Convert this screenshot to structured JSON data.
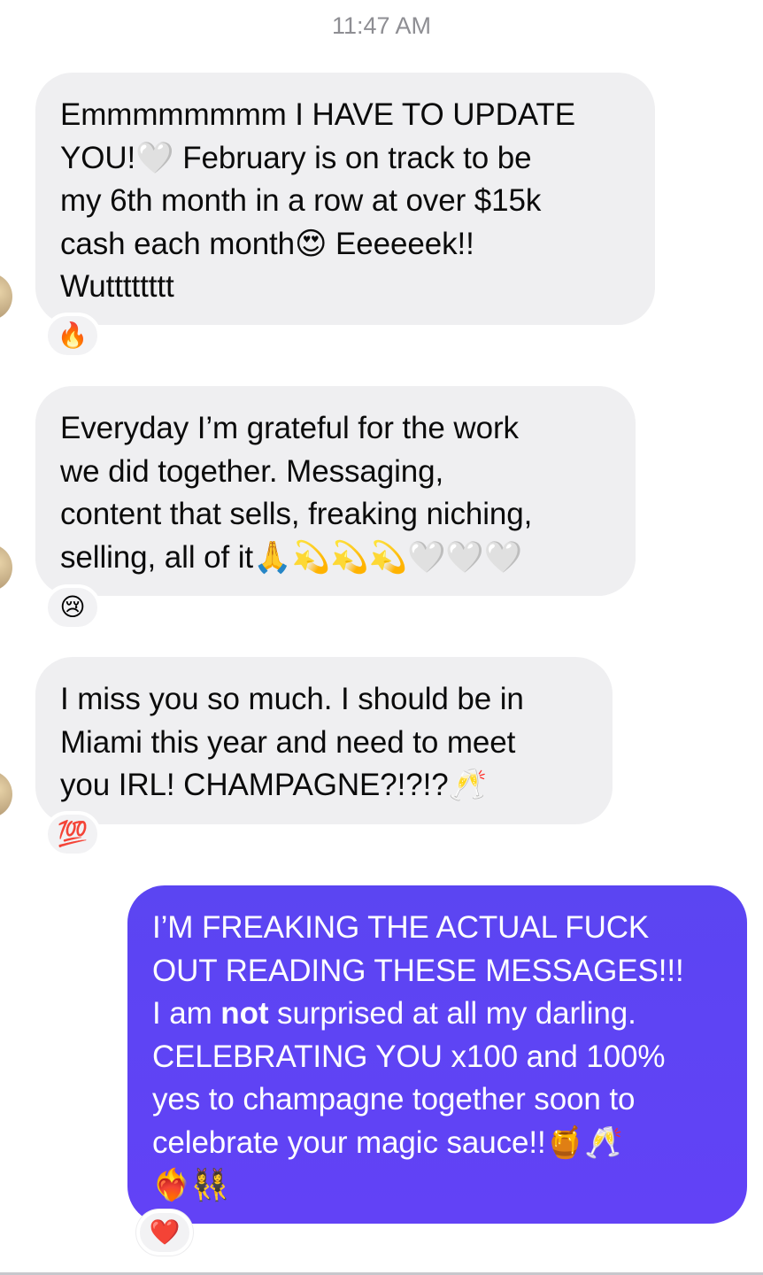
{
  "timestamp": "11:47 AM",
  "messages": [
    {
      "direction": "in",
      "lines": [
        "Emmmmmmmm I HAVE TO UPDATE",
        "YOU!🤍 February is on track to be",
        "my 6th month in a row at over $15k",
        "cash each month😍 Eeeeeek!!",
        "Wutttttttt"
      ],
      "reaction": "🔥"
    },
    {
      "direction": "in",
      "lines": [
        "Everyday I’m grateful for the work",
        "we did together. Messaging,",
        "content that sells, freaking niching,",
        "selling, all of it🙏💫💫💫🤍🤍🤍"
      ],
      "reaction": "😢"
    },
    {
      "direction": "in",
      "lines": [
        "I miss you so much. I should be in",
        "Miami this year and need to meet",
        "you IRL! CHAMPAGNE?!?!?🥂"
      ],
      "reaction": "💯"
    },
    {
      "direction": "out",
      "lines": [
        "I’M FREAKING THE ACTUAL FUCK",
        "OUT READING THESE MESSAGES!!!",
        "surprised at all my darling.",
        "CELEBRATING YOU x100 and 100%",
        "yes to champagne together soon to",
        "celebrate your magic sauce!!🍯🥂",
        "❤️‍🔥👯‍♀️"
      ],
      "line3_prefix": "I am ",
      "line3_bold": "not",
      "reaction": "❤️"
    }
  ],
  "colors": {
    "incoming_bubble": "#efeff1",
    "outgoing_bubble": "#6543f5",
    "timestamp": "#8e8e93"
  }
}
